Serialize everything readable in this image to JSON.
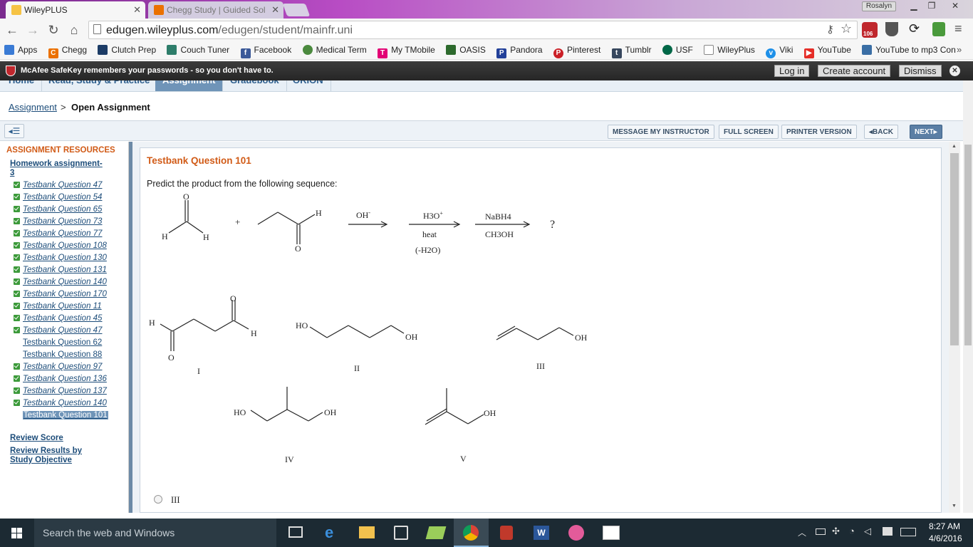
{
  "browser": {
    "tabs": [
      {
        "title": "WileyPLUS",
        "icon_color": "#f0a500"
      },
      {
        "title": "Chegg Study | Guided Sol",
        "icon_color": "#eb7100"
      }
    ],
    "user": "Rosalyn",
    "url_host": "edugen.wileyplus.com",
    "url_path": "/edugen/student/mainfr.uni",
    "extension_badge": "106",
    "bookmarks": [
      {
        "label": "Apps",
        "icon": "apps-grid-icon"
      },
      {
        "label": "Chegg",
        "icon": "chegg-icon"
      },
      {
        "label": "Clutch Prep",
        "icon": "clutch-prep-icon"
      },
      {
        "label": "Couch Tuner",
        "icon": "couch-tuner-icon"
      },
      {
        "label": "Facebook",
        "icon": "facebook-icon"
      },
      {
        "label": "Medical Term",
        "icon": "globe-icon"
      },
      {
        "label": "My TMobile",
        "icon": "tmobile-icon"
      },
      {
        "label": "OASIS",
        "icon": "oasis-icon"
      },
      {
        "label": "Pandora",
        "icon": "pandora-icon"
      },
      {
        "label": "Pinterest",
        "icon": "pinterest-icon"
      },
      {
        "label": "Tumblr",
        "icon": "tumblr-icon"
      },
      {
        "label": "USF",
        "icon": "usf-icon"
      },
      {
        "label": "WileyPlus",
        "icon": "page-icon"
      },
      {
        "label": "Viki",
        "icon": "viki-icon"
      },
      {
        "label": "YouTube",
        "icon": "youtube-icon"
      },
      {
        "label": "YouTube to mp3 Con",
        "icon": "yt-mp3-icon"
      }
    ]
  },
  "mcafee": {
    "message": "McAfee SafeKey remembers your passwords - so you don't have to.",
    "login": "Log in",
    "create": "Create account",
    "dismiss": "Dismiss"
  },
  "nav_tabs": [
    "Home",
    "Read, Study & Practice",
    "Assignment",
    "Gradebook",
    "ORION"
  ],
  "breadcrumb": {
    "link": "Assignment",
    "separator": ">",
    "current": "Open Assignment"
  },
  "toolbar": {
    "message": "MESSAGE MY INSTRUCTOR",
    "fullscreen": "FULL SCREEN",
    "printer": "PRINTER VERSION",
    "back": "BACK",
    "next": "NEXT"
  },
  "sidebar": {
    "heading": "ASSIGNMENT RESOURCES",
    "assignment_line1": "Homework assignment-",
    "assignment_line2": "3",
    "items": [
      {
        "label": "Testbank Question 47",
        "done": true
      },
      {
        "label": "Testbank Question 54",
        "done": true
      },
      {
        "label": "Testbank Question 65",
        "done": true
      },
      {
        "label": "Testbank Question 73",
        "done": true
      },
      {
        "label": "Testbank Question 77",
        "done": true
      },
      {
        "label": "Testbank Question 108",
        "done": true
      },
      {
        "label": "Testbank Question 130",
        "done": true
      },
      {
        "label": "Testbank Question 131",
        "done": true
      },
      {
        "label": "Testbank Question 140",
        "done": true
      },
      {
        "label": "Testbank Question 170",
        "done": true
      },
      {
        "label": "Testbank Question 11",
        "done": true
      },
      {
        "label": "Testbank Question 45",
        "done": true
      },
      {
        "label": "Testbank Question 47",
        "done": true
      },
      {
        "label": "Testbank Question 62",
        "done": false
      },
      {
        "label": "Testbank Question 88",
        "done": false
      },
      {
        "label": "Testbank Question 97",
        "done": true
      },
      {
        "label": "Testbank Question 136",
        "done": true
      },
      {
        "label": "Testbank Question 137",
        "done": true
      },
      {
        "label": "Testbank Question 140",
        "done": true
      },
      {
        "label": "Testbank Question 101",
        "done": false,
        "current": true
      }
    ],
    "review_score": "Review Score",
    "review_results_line1": "Review Results by",
    "review_results_line2": "Study Objective"
  },
  "question": {
    "title": "Testbank Question 101",
    "prompt": "Predict the product from the following sequence:",
    "reaction": {
      "step1": "OH",
      "step2_top": "H3O",
      "step2_mid": "heat",
      "step2_bottom": "(-H2O)",
      "step3_top": "NaBH4",
      "step3_bottom": "CH3OH",
      "plus": "+",
      "result": "?"
    },
    "atom_labels": {
      "O": "O",
      "H": "H",
      "HO": "HO",
      "OH": "OH"
    },
    "options": [
      "I",
      "II",
      "III",
      "IV",
      "V"
    ],
    "visible_answer": "III"
  },
  "taskbar": {
    "search_placeholder": "Search the web and Windows",
    "time": "8:27 AM",
    "date": "4/6/2016"
  }
}
